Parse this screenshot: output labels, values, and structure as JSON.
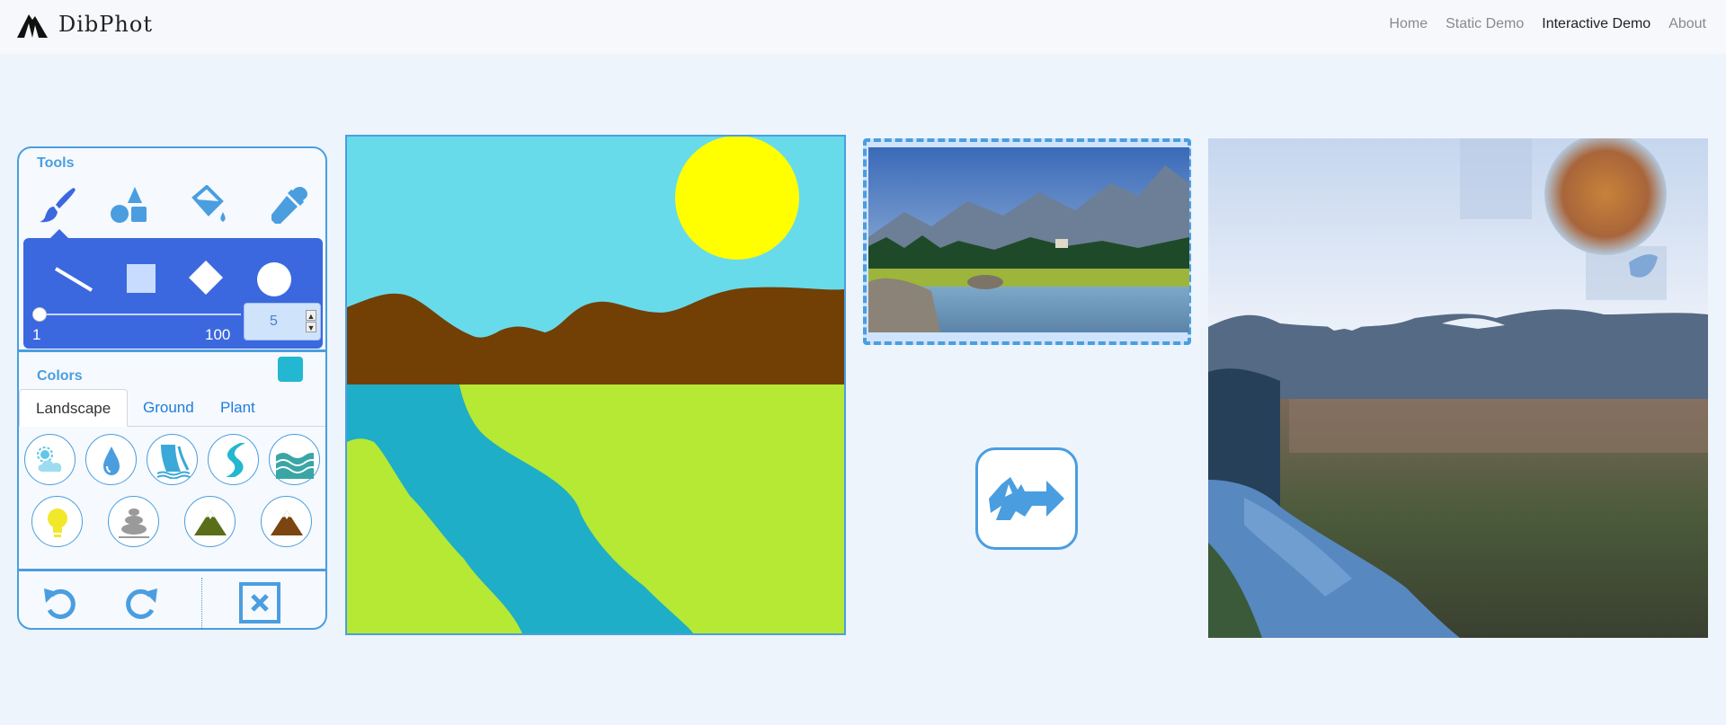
{
  "brand": {
    "name": "DibPhot",
    "logo_icon": "mountain-logo-icon"
  },
  "nav": {
    "links": [
      {
        "label": "Home",
        "active": false
      },
      {
        "label": "Static Demo",
        "active": false
      },
      {
        "label": "Interactive Demo",
        "active": true
      },
      {
        "label": "About",
        "active": false
      }
    ]
  },
  "tools": {
    "title": "Tools",
    "items": [
      {
        "icon": "brush-icon",
        "selected": true
      },
      {
        "icon": "shapes-icon",
        "selected": false
      },
      {
        "icon": "paint-bucket-icon",
        "selected": false
      },
      {
        "icon": "eyedropper-icon",
        "selected": false
      }
    ],
    "shapes": [
      "line-icon",
      "square-icon",
      "diamond-icon",
      "circle-icon"
    ],
    "size": {
      "min": "1",
      "max": "100",
      "value": "5"
    }
  },
  "colors": {
    "title": "Colors",
    "current": "#23b7d1",
    "tabs": [
      {
        "label": "Landscape",
        "active": true
      },
      {
        "label": "Ground",
        "active": false
      },
      {
        "label": "Plant",
        "active": false
      }
    ],
    "swatches": [
      {
        "icon": "sky-icon",
        "color": "#60c8e6"
      },
      {
        "icon": "water-drop-icon",
        "color": "#4a9ee0"
      },
      {
        "icon": "waterfall-icon",
        "color": "#3aa8d8"
      },
      {
        "icon": "river-icon",
        "color": "#23b7d1"
      },
      {
        "icon": "sea-icon",
        "color": "#2a9a9a"
      },
      {
        "icon": "light-icon",
        "color": "#f2e82a"
      },
      {
        "icon": "stone-icon",
        "color": "#9a9a9a"
      },
      {
        "icon": "hill-icon",
        "color": "#5a6e1a"
      },
      {
        "icon": "mountain-icon",
        "color": "#7a4510"
      }
    ]
  },
  "actions": {
    "undo_icon": "undo-icon",
    "redo_icon": "redo-icon",
    "clear_icon": "clear-canvas-icon"
  },
  "canvas": {
    "sky": "#68dbeb",
    "sun": "#ffff00",
    "mountain": "#724004",
    "grass": "#b5e933",
    "river": "#1faec8"
  },
  "generate": {
    "icon": "generate-arrow-icon"
  }
}
